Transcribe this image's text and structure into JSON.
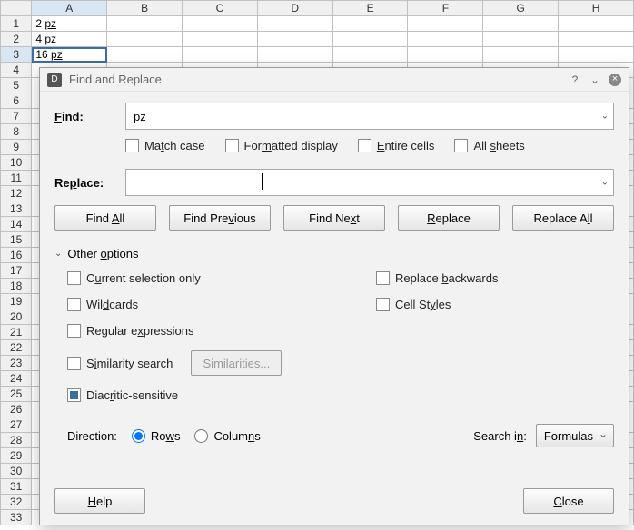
{
  "sheet": {
    "columns": [
      "A",
      "B",
      "C",
      "D",
      "E",
      "F",
      "G",
      "H"
    ],
    "rows_visible": 33,
    "selected_cell": "A3",
    "data": {
      "A1": "2 pz",
      "A2": "4 pz",
      "A3": "16 pz"
    }
  },
  "dialog": {
    "title": "Find and Replace",
    "find_label": "Find:",
    "find_value": "pz",
    "replace_label": "Replace:",
    "replace_value": "",
    "checks": {
      "match_case": "Match case",
      "formatted": "Formatted display",
      "entire": "Entire cells",
      "allsheets": "All sheets"
    },
    "buttons": {
      "find_all": "Find All",
      "find_prev": "Find Previous",
      "find_next": "Find Next",
      "replace": "Replace",
      "replace_all": "Replace All"
    },
    "other_options_label": "Other options",
    "options": {
      "cur_sel": "Current selection only",
      "wildcards": "Wildcards",
      "regex": "Regular expressions",
      "similarity": "Similarity search",
      "similarities_btn": "Similarities...",
      "diacritic": "Diacritic-sensitive",
      "replace_back": "Replace backwards",
      "cell_styles": "Cell Styles"
    },
    "direction_label": "Direction:",
    "direction": {
      "rows": "Rows",
      "columns": "Columns",
      "selected": "rows"
    },
    "search_in_label": "Search in:",
    "search_in_value": "Formulas",
    "help": "Help",
    "close": "Close"
  }
}
